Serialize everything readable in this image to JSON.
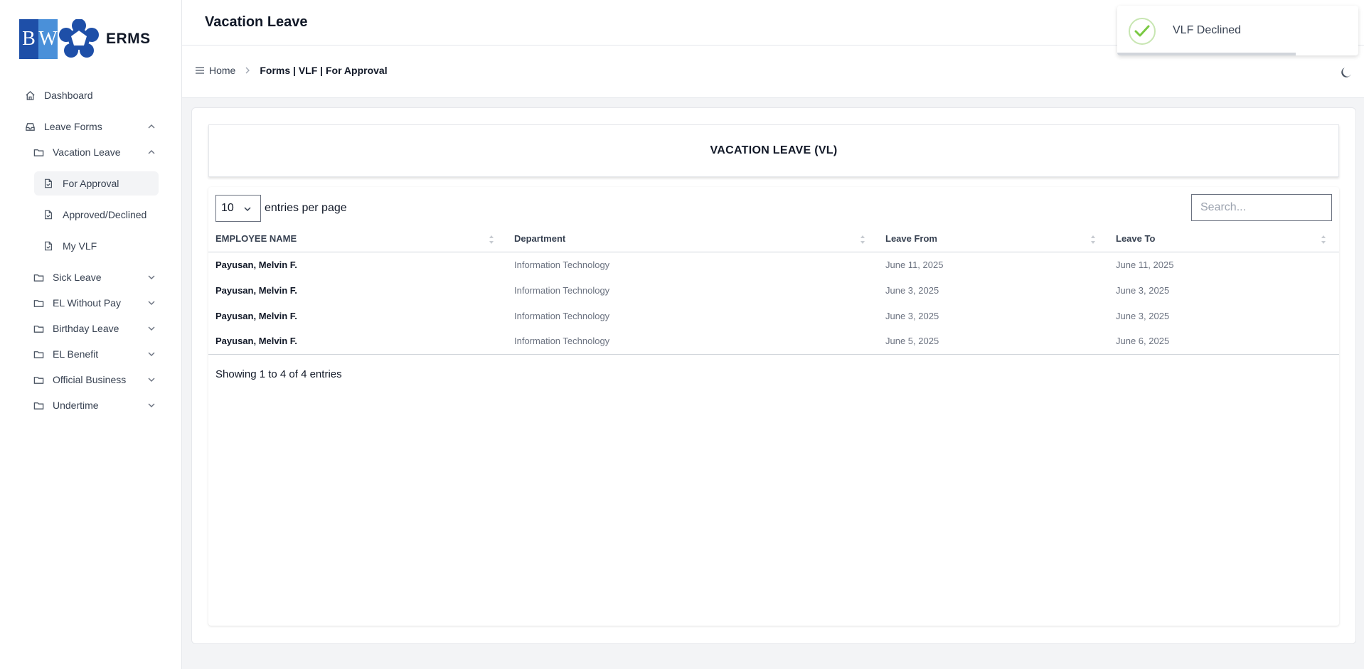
{
  "app": {
    "logo_text": "ERMS",
    "logo_letters": [
      "B",
      "W"
    ]
  },
  "sidebar": {
    "items": [
      {
        "label": "Dashboard",
        "icon": "home-icon"
      },
      {
        "label": "Leave Forms",
        "icon": "inbox-icon"
      },
      {
        "label": "Vacation Leave",
        "icon": "folder-icon"
      },
      {
        "label": "For Approval",
        "icon": "file-icon"
      },
      {
        "label": "Approved/Declined",
        "icon": "file-icon"
      },
      {
        "label": "My VLF",
        "icon": "file-icon"
      },
      {
        "label": "Sick Leave",
        "icon": "folder-icon"
      },
      {
        "label": "EL Without Pay",
        "icon": "folder-icon"
      },
      {
        "label": "Birthday Leave",
        "icon": "folder-icon"
      },
      {
        "label": "EL Benefit",
        "icon": "folder-icon"
      },
      {
        "label": "Official Business",
        "icon": "folder-icon"
      },
      {
        "label": "Undertime",
        "icon": "folder-icon"
      }
    ]
  },
  "header": {
    "title": "Vacation Leave"
  },
  "breadcrumb": {
    "home": "Home",
    "current": "Forms | VLF | For Approval"
  },
  "card": {
    "title": "VACATION LEAVE (VL)"
  },
  "table": {
    "per_page_value": "10",
    "per_page_label": "entries per page",
    "search_placeholder": "Search...",
    "columns": [
      "EMPLOYEE NAME",
      "Department",
      "Leave From",
      "Leave To"
    ],
    "rows": [
      {
        "name": "Payusan, Melvin F.",
        "department": "Information Technology",
        "from": "June 11, 2025",
        "to": "June 11, 2025"
      },
      {
        "name": "Payusan, Melvin F.",
        "department": "Information Technology",
        "from": "June 3, 2025",
        "to": "June 3, 2025"
      },
      {
        "name": "Payusan, Melvin F.",
        "department": "Information Technology",
        "from": "June 3, 2025",
        "to": "June 3, 2025"
      },
      {
        "name": "Payusan, Melvin F.",
        "department": "Information Technology",
        "from": "June 5, 2025",
        "to": "June 6, 2025"
      }
    ],
    "showing": "Showing 1 to 4 of 4 entries"
  },
  "toast": {
    "message": "VLF Declined",
    "status_color": "#7ac943",
    "progress": 0.74
  }
}
